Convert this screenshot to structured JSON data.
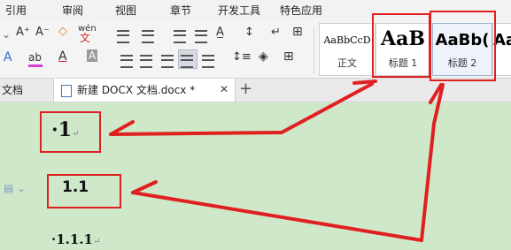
{
  "menu": {
    "items": [
      "引用",
      "审阅",
      "视图",
      "章节",
      "开发工具",
      "特色应用"
    ]
  },
  "ribbon": {
    "font_grow": "A⁺",
    "font_shrink": "A⁻",
    "clear_format": "◇",
    "pinyin": "wén",
    "font_color_letter": "A",
    "highlight_letter": "ab",
    "char_shade_letter": "A",
    "text_effect_letter": "A"
  },
  "styles": [
    {
      "sample": "AaBbCcD",
      "caption": "正文"
    },
    {
      "sample": "AaB",
      "caption": "标题 1"
    },
    {
      "sample": "AaBb(",
      "caption": "标题 2"
    },
    {
      "sample": "Aa",
      "caption": ""
    }
  ],
  "tabs": {
    "left_partial": "文档",
    "active_label": "新建 DOCX 文档.docx *",
    "close_glyph": "✕",
    "add_glyph": "+"
  },
  "document": {
    "heading1": "·1",
    "heading2": "1.1",
    "heading3": "·1.1.1",
    "para_mark": "↵"
  },
  "colors": {
    "annotation": "#e02020",
    "doc_bg": "#cfe8c9"
  }
}
